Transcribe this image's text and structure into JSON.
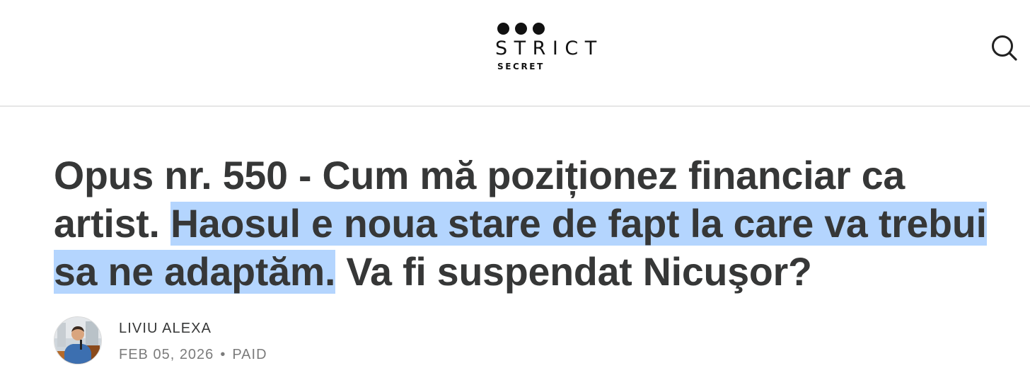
{
  "header": {
    "logo": {
      "word_1": "STRICT",
      "word_2": "SECRET"
    },
    "search_icon": "search-icon"
  },
  "article": {
    "title": {
      "part_1": "Opus nr. 550 - Cum mă poziționez financiar ca artist. ",
      "part_2_highlighted": "Haosul e noua stare de fapt la care va trebui sa ne adaptăm.",
      "part_3": " Va fi suspendat Nicuşor?"
    },
    "highlight_color": "#b4d5fe",
    "author": "LIVIU ALEXA",
    "date": "FEB 05, 2026",
    "separator": "•",
    "access": "PAID"
  }
}
